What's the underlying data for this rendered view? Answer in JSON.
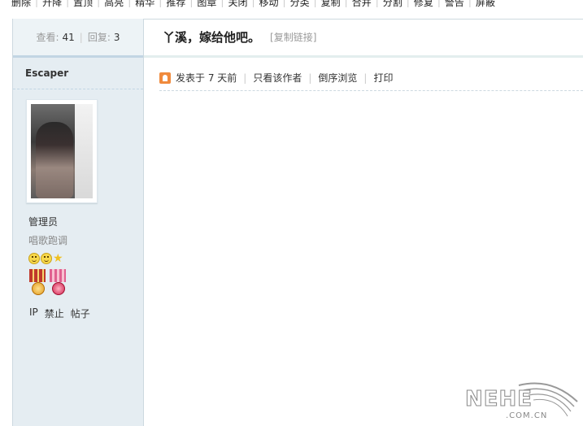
{
  "moderation_toolbar": {
    "items": [
      "删除",
      "升降",
      "置顶",
      "高亮",
      "精华",
      "推荐",
      "图章",
      "关闭",
      "移动",
      "分类",
      "复制",
      "合并",
      "分割",
      "修复",
      "警告",
      "屏蔽"
    ]
  },
  "sidebar": {
    "views_label": "查看:",
    "views_value": "41",
    "replies_label": "回复:",
    "replies_value": "3",
    "author_name": "Escaper",
    "role": "管理员",
    "user_group": "唱歌跑调",
    "mod_links": [
      "IP",
      "禁止",
      "帖子"
    ]
  },
  "post": {
    "title": "丫溪，嫁给他吧。",
    "copy_link": "[复制链接]",
    "posted": "发表于 7 天前",
    "only_author": "只看该作者",
    "reverse_browse": "倒序浏览",
    "print": "打印"
  },
  "watermark": {
    "brand": "NEHE",
    "domain": ".COM.CN"
  }
}
